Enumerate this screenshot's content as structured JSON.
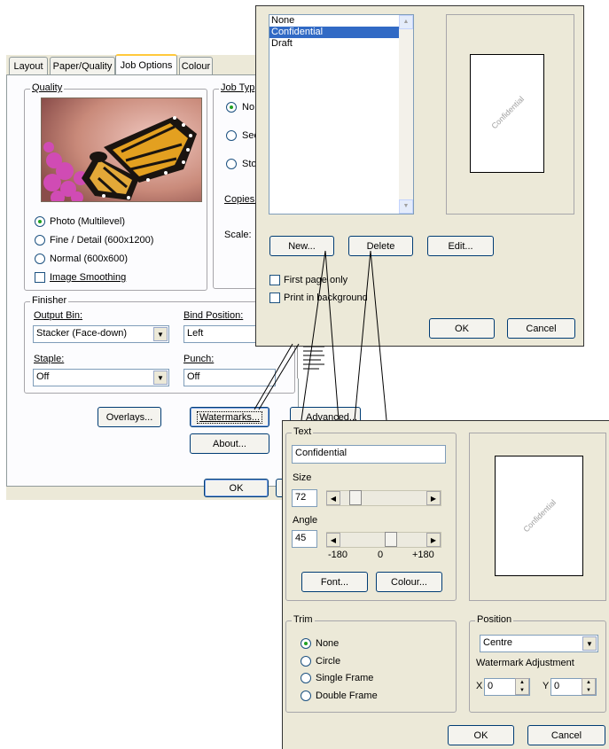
{
  "job_options": {
    "tabs": [
      "Layout",
      "Paper/Quality",
      "Job Options",
      "Colour"
    ],
    "quality": {
      "label": "Quality",
      "options": [
        "Photo (Multilevel)",
        "Fine / Detail (600x1200)",
        "Normal (600x600)"
      ],
      "smoothing": "Image Smoothing"
    },
    "job_type": {
      "label": "Job Typ",
      "options": [
        "No",
        "Sec",
        "Sto"
      ]
    },
    "copies_label": "Copies:",
    "scale_label": "Scale:",
    "finisher": {
      "label": "Finisher",
      "output_bin_label": "Output Bin:",
      "output_bin_value": "Stacker (Face-down)",
      "bind_label": "Bind Position:",
      "bind_value": "Left",
      "staple_label": "Staple:",
      "staple_value": "Off",
      "punch_label": "Punch:",
      "punch_value": "Off"
    },
    "overlays_btn": "Overlays...",
    "watermarks_btn": "Watermarks...",
    "advanced_btn": "Advanced...",
    "about_btn": "About...",
    "ok_btn": "OK"
  },
  "watermark_list": {
    "items": [
      "None",
      "Confidential",
      "Draft"
    ],
    "selected": "Confidential",
    "preview_text": "Confidential",
    "new_btn": "New...",
    "delete_btn": "Delete",
    "edit_btn": "Edit...",
    "first_page_label": "First page only",
    "background_label": "Print in background",
    "ok_btn": "OK",
    "cancel_btn": "Cancel"
  },
  "edit_watermark": {
    "text_group": "Text",
    "text_value": "Confidential",
    "size_label": "Size",
    "size_value": "72",
    "angle_label": "Angle",
    "angle_value": "45",
    "angle_min": "-180",
    "angle_mid": "0",
    "angle_max": "+180",
    "font_btn": "Font...",
    "colour_btn": "Colour...",
    "preview_text": "Confidential",
    "trim_group": "Trim",
    "trim_options": [
      "None",
      "Circle",
      "Single Frame",
      "Double Frame"
    ],
    "position_group": "Position",
    "position_value": "Centre",
    "adjust_label": "Watermark Adjustment",
    "x_label": "X",
    "x_value": "0",
    "y_label": "Y",
    "y_value": "0",
    "ok_btn": "OK",
    "cancel_btn": "Cancel"
  }
}
